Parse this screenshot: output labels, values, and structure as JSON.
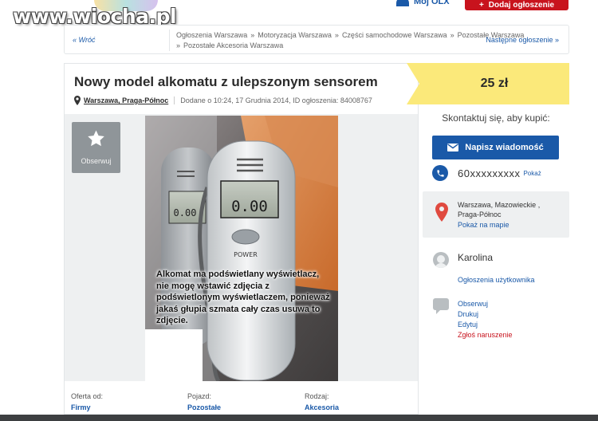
{
  "watermark": "www.wiocha.pl",
  "header": {
    "account_label": "Mój OLX",
    "add_ad_label": "Dodaj ogłoszenie",
    "add_ad_color": "#c8131d"
  },
  "breadcrumb": {
    "back": "« Wróć",
    "items": [
      "Ogłoszenia Warszawa",
      "Motoryzacja Warszawa",
      "Części samochodowe Warszawa",
      "Pozostałe Warszawa",
      "Pozostałe Akcesoria Warszawa"
    ],
    "separator": "»",
    "next": "Następne ogłoszenie »"
  },
  "listing": {
    "title": "Nowy model alkomatu z ulepszonym sensorem",
    "location": "Warszawa, Praga-Północ",
    "added": "Dodane o 10:24, 17 Grudnia 2014, ID ogłoszenia: 84008767",
    "price": "25 zł",
    "price_color": "#fbe97a"
  },
  "gallery": {
    "follow_label": "Obserwuj",
    "device_label": "POWER",
    "display_small": "0.00",
    "display_big": "0.00",
    "photo_caption": "Alkomat ma podświetlany wyświetlacz, nie mogę wstawić zdjęcia z podświetlonym wyświetlaczem, ponieważ jakaś głupia szmata cały czas usuwa to zdjęcie."
  },
  "details": [
    {
      "key": "Oferta od:",
      "value": "Firmy"
    },
    {
      "key": "Pojazd:",
      "value": "Pozostałe"
    },
    {
      "key": "Rodzaj:",
      "value": "Akcesoria"
    }
  ],
  "sidebar": {
    "contact_title": "Skontaktuj się, aby kupić:",
    "message_button": "Napisz wiadomość",
    "phone": "60xxxxxxxxx",
    "show_phone": "Pokaż",
    "address_line1": "Warszawa, Mazowieckie ,",
    "address_line2": "Praga-Północ",
    "map_link": "Pokaż na mapie",
    "user_name": "Karolina",
    "user_ads": "Ogłoszenia użytkownika",
    "actions": [
      "Obserwuj",
      "Drukuj",
      "Edytuj"
    ],
    "report": "Zgłoś naruszenie",
    "accent_color": "#1a59a8"
  }
}
